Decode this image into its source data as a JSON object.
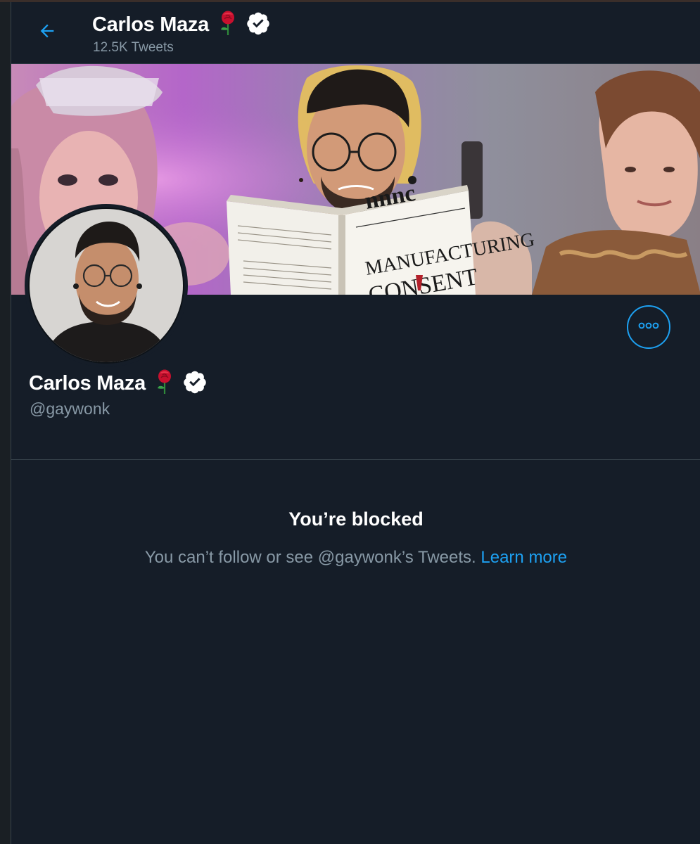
{
  "header": {
    "title": "Carlos Maza",
    "tweet_count": "12.5K Tweets",
    "back_icon": "arrow-left-icon"
  },
  "banner": {
    "book_title_line1": "MANUFACTURING",
    "book_title_line2": "CONSENT"
  },
  "profile": {
    "name": "Carlos Maza",
    "handle": "@gaywonk",
    "name_emoji": "rose-icon",
    "verified_icon": "verified-badge-icon",
    "more_icon": "more-options-icon"
  },
  "blocked": {
    "title": "You’re blocked",
    "message": "You can’t follow or see @gaywonk’s Tweets.",
    "link_label": "Learn more"
  },
  "colors": {
    "background": "#151d28",
    "accent": "#1da1f2",
    "secondary_text": "#8899a6",
    "border": "#38444d"
  }
}
